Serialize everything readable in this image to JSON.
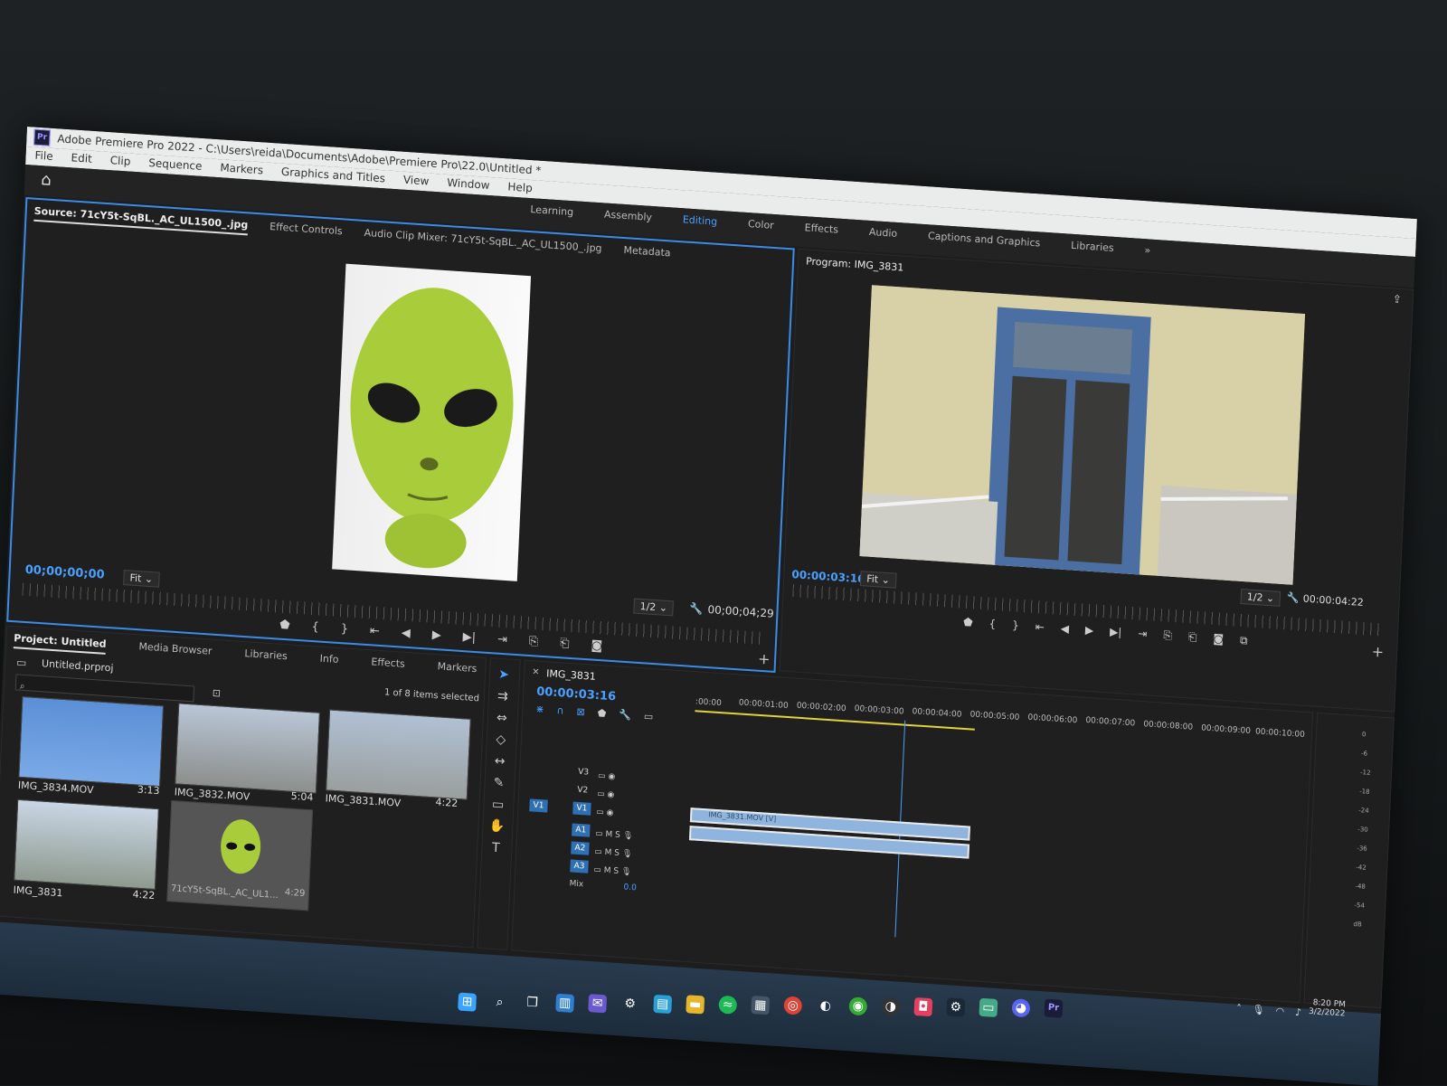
{
  "window": {
    "title": "Adobe Premiere Pro 2022 - C:\\Users\\reida\\Documents\\Adobe\\Premiere Pro\\22.0\\Untitled *",
    "logo": "Pr"
  },
  "menu": [
    "File",
    "Edit",
    "Clip",
    "Sequence",
    "Markers",
    "Graphics and Titles",
    "View",
    "Window",
    "Help"
  ],
  "workspaces": {
    "items": [
      "Learning",
      "Assembly",
      "Editing",
      "Color",
      "Effects",
      "Audio",
      "Captions and Graphics",
      "Libraries"
    ],
    "active": "Editing",
    "overflow": "»"
  },
  "source_panel": {
    "tabs": [
      "Source: 71cY5t-SqBL._AC_UL1500_.jpg",
      "Effect Controls",
      "Audio Clip Mixer: 71cY5t-SqBL._AC_UL1500_.jpg",
      "Metadata"
    ],
    "timecode": "00;00;00;00",
    "fit": "Fit",
    "resolution": "1/2",
    "duration": "00;00;04;29"
  },
  "program_panel": {
    "title": "Program: IMG_3831",
    "timecode": "00:00:03:16",
    "fit": "Fit",
    "resolution": "1/2",
    "duration": "00:00:04:22"
  },
  "project_panel": {
    "tabs": [
      "Project: Untitled",
      "Media Browser",
      "Libraries",
      "Info",
      "Effects",
      "Markers"
    ],
    "file": "Untitled.prproj",
    "selection": "1 of 8 items selected",
    "items": [
      {
        "name": "IMG_3834.MOV",
        "duration": "3:13"
      },
      {
        "name": "IMG_3832.MOV",
        "duration": "5:04"
      },
      {
        "name": "IMG_3831.MOV",
        "duration": "4:22"
      },
      {
        "name": "IMG_3831",
        "duration": "4:22"
      },
      {
        "name": "71cY5t-SqBL._AC_UL1...",
        "duration": "4:29"
      }
    ]
  },
  "timeline": {
    "sequence": "IMG_3831",
    "timecode": "00:00:03:16",
    "ruler": [
      ":00:00",
      "00:00:01:00",
      "00:00:02:00",
      "00:00:03:00",
      "00:00:04:00",
      "00:00:05:00",
      "00:00:06:00",
      "00:00:07:00",
      "00:00:08:00",
      "00:00:09:00",
      "00:00:10:00"
    ],
    "video_tracks": [
      "V3",
      "V2",
      "V1"
    ],
    "audio_tracks": [
      "A1",
      "A2",
      "A3"
    ],
    "source_patch": "V1",
    "mix_label": "Mix",
    "mix_value": "0.0",
    "mute": "M",
    "solo": "S",
    "clip_label": "IMG_3831.MOV [V]"
  },
  "meter_scale": [
    "0",
    "-6",
    "-12",
    "-18",
    "-24",
    "-30",
    "-36",
    "-42",
    "-48",
    "-54",
    "dB"
  ],
  "taskbar": {
    "time": "8:20 PM",
    "date": "3/2/2022"
  },
  "colors": {
    "accent": "#3c8ce7",
    "timecode": "#4aa0ff",
    "clip": "#8fb4dd"
  }
}
